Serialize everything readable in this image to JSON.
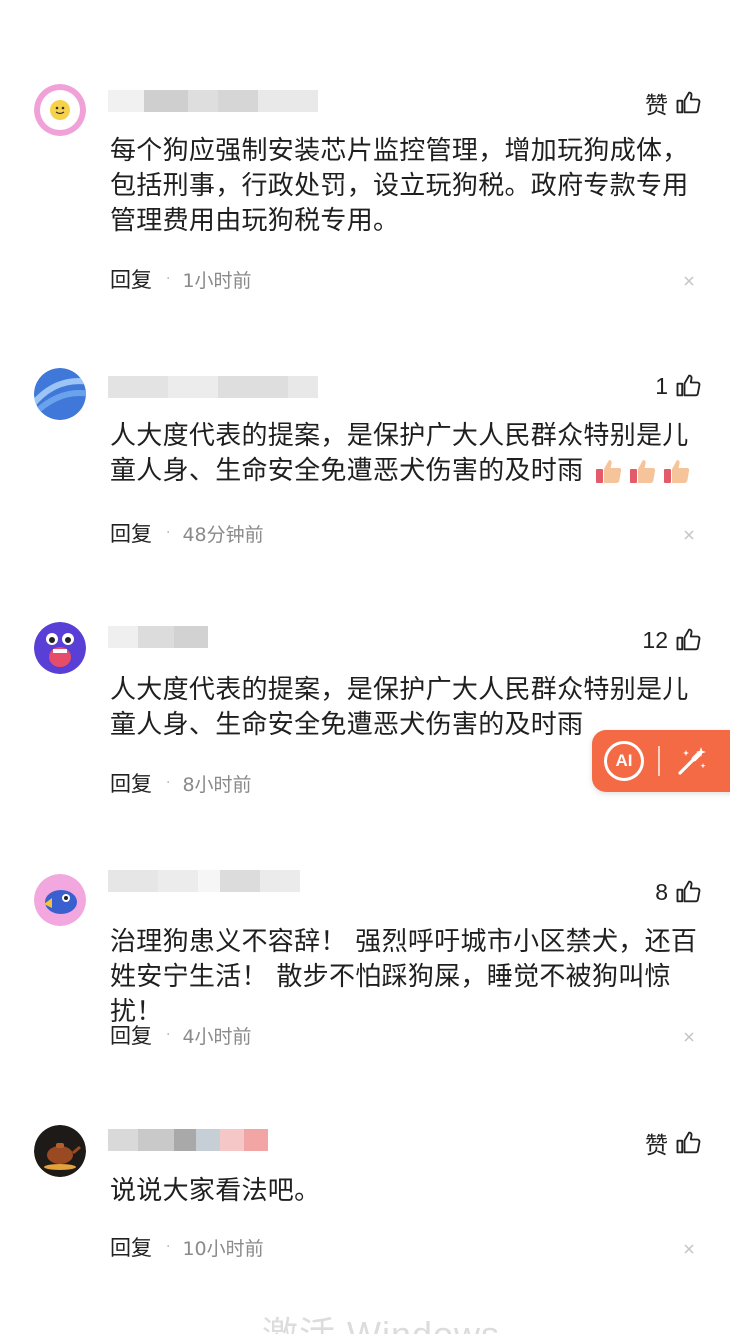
{
  "comments": [
    {
      "text": "每个狗应强制安装芯片监控管理，增加玩狗成体，包括刑事，行政处罚，设立玩狗税。政府专款专用管理费用由玩狗税专用。",
      "likes": "赞",
      "reply_label": "回复",
      "time": "1小时前",
      "avatar_icon": "yellow-face-avatar"
    },
    {
      "text": "人大度代表的提案，是保护广大人民群众特别是儿童人身、生命安全免遭恶犬伤害的及时雨",
      "likes": "1",
      "reply_label": "回复",
      "time": "48分钟前",
      "avatar_icon": "blue-wave-avatar",
      "emoji": [
        "thumbs-up-emoji",
        "thumbs-up-emoji",
        "thumbs-up-emoji"
      ]
    },
    {
      "text": "人大度代表的提案，是保护广大人民群众特别是儿童人身、生命安全免遭恶犬伤害的及时雨",
      "likes": "12",
      "reply_label": "回复",
      "time": "8小时前",
      "avatar_icon": "purple-monster-avatar"
    },
    {
      "text": "治理狗患义不容辞！ 强烈呼吁城市小区禁犬，还百姓安宁生活！ 散步不怕踩狗屎，睡觉不被狗叫惊扰！",
      "likes": "8",
      "reply_label": "回复",
      "time": "4小时前",
      "avatar_icon": "blue-bird-avatar"
    },
    {
      "text": "说说大家看法吧。",
      "likes": "赞",
      "reply_label": "回复",
      "time": "10小时前",
      "avatar_icon": "teapot-avatar"
    }
  ],
  "ai_button": {
    "label": "AI"
  },
  "watermark": "激活 Windows",
  "colors": {
    "ai_button": "#f46a45",
    "text": "#1f1f1f",
    "meta": "#8a8a8a"
  }
}
